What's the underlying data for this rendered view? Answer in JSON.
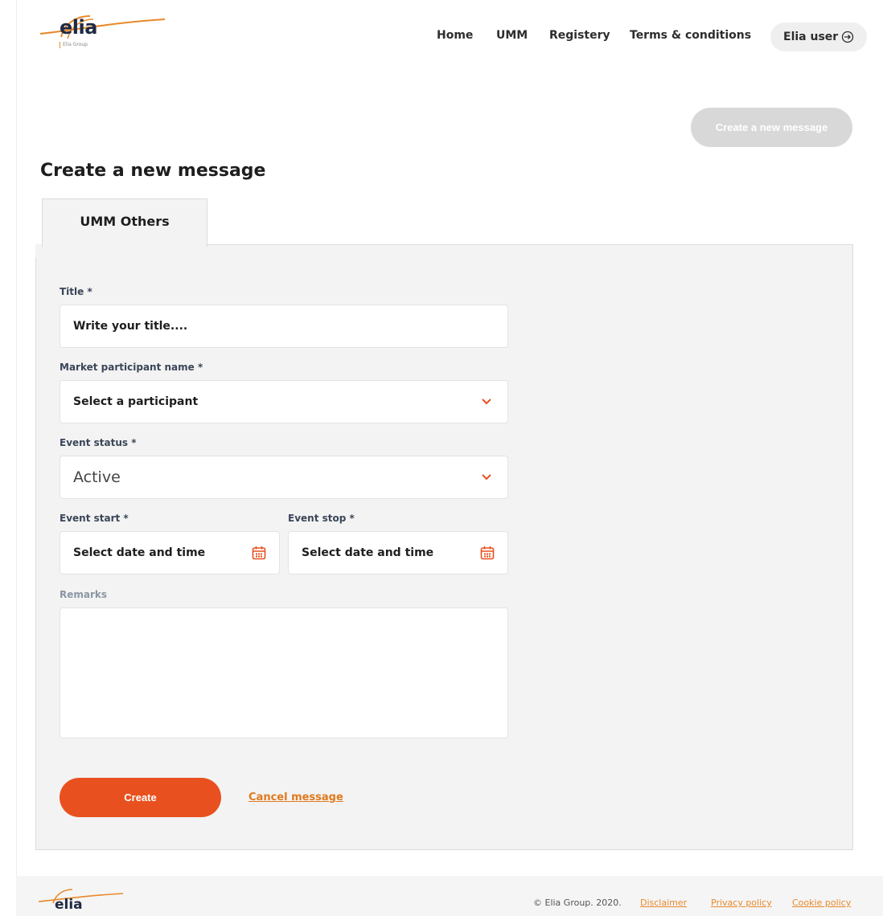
{
  "brand": {
    "name": "elia",
    "subtitle": "Elia Group"
  },
  "nav": {
    "home": "Home",
    "umm": "UMM",
    "registery": "Registery",
    "terms": "Terms & conditions"
  },
  "user": {
    "name": "Elia user",
    "logout_icon": "logout-icon"
  },
  "top_button": "Create a new message",
  "page_title": "Create a new message",
  "tab": "UMM Others",
  "form": {
    "title_label": "Title *",
    "title_placeholder": "Write your title....",
    "participant_label": "Market participant name *",
    "participant_value": "Select a participant",
    "status_label": "Event status *",
    "status_value": "Active",
    "start_label": "Event start *",
    "start_value": "Select date and time",
    "stop_label": "Event stop *",
    "stop_value": "Select date and time",
    "remarks_label": "Remarks",
    "remarks_value": ""
  },
  "actions": {
    "create": "Create",
    "cancel": "Cancel message"
  },
  "footer": {
    "brand": "elia",
    "copyright": "© Elia Group. 2020.",
    "disclaimer": "Disclaimer",
    "privacy": "Privacy policy",
    "cookie": "Cookie policy"
  },
  "colors": {
    "accent": "#e8511f",
    "brand_orange": "#e8892b",
    "navy": "#1f2a44",
    "panel": "#f3f3f3"
  }
}
